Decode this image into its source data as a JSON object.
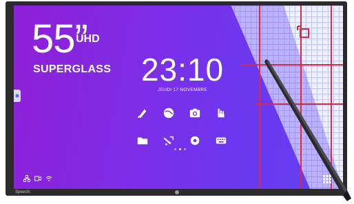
{
  "product": {
    "size": "55”",
    "resolution": "UHD",
    "glass": "SUPERGLASS"
  },
  "home": {
    "time": "23:10",
    "date": "JEUDI 17 NOVEMBRE"
  },
  "apps": [
    {
      "name": "whiteboard-icon"
    },
    {
      "name": "browser-icon"
    },
    {
      "name": "camera-icon"
    },
    {
      "name": "gesture-icon"
    },
    {
      "name": "folder-icon"
    },
    {
      "name": "annotate-icon"
    },
    {
      "name": "settings-icon"
    },
    {
      "name": "keyboard-icon"
    }
  ],
  "page_indicator": {
    "pages": 3,
    "current": 2
  },
  "status_icons": [
    "network-icon",
    "input-source-icon",
    "wifi-icon"
  ],
  "brand": "Speechi",
  "colors": {
    "accent_purple": "#7d2ee6",
    "grid_red": "#e0283a",
    "bezel": "#2b2b2e"
  }
}
